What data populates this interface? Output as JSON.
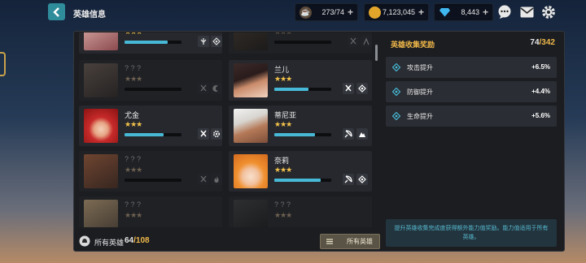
{
  "header": {
    "title": "英雄信息"
  },
  "resources": {
    "stamina": "273/74",
    "gold": "7,123,045",
    "gems": "8,443"
  },
  "heroes": [
    {
      "name": "",
      "stars": "★★★",
      "locked": false,
      "progress": 0.75
    },
    {
      "name": "",
      "stars": "★★★",
      "locked": true,
      "progress": 0.0
    },
    {
      "name": "? ? ?",
      "stars": "★★★",
      "locked": true,
      "progress": 0.0
    },
    {
      "name": "兰儿",
      "stars": "★★★",
      "locked": false,
      "progress": 0.6
    },
    {
      "name": "尤金",
      "stars": "★★★",
      "locked": false,
      "progress": 0.68
    },
    {
      "name": "蒂尼亚",
      "stars": "★★★",
      "locked": false,
      "progress": 0.72
    },
    {
      "name": "? ? ?",
      "stars": "★★★",
      "locked": true,
      "progress": 0.0
    },
    {
      "name": "奈莉",
      "stars": "★★★",
      "locked": false,
      "progress": 0.82
    },
    {
      "name": "? ? ?",
      "stars": "★★★",
      "locked": true,
      "progress": 0.0
    },
    {
      "name": "? ? ?",
      "stars": "★★★",
      "locked": true,
      "progress": 0.0
    }
  ],
  "footer": {
    "all_heroes_label": "所有英雄",
    "count": "64",
    "total": "/108",
    "filter_label": "所有英雄"
  },
  "collection": {
    "title": "英雄收集奖励",
    "count": "74",
    "total": "/342",
    "stats": [
      {
        "label": "攻击提升",
        "value": "+6.5%"
      },
      {
        "label": "防御提升",
        "value": "+4.4%"
      },
      {
        "label": "生命提升",
        "value": "+5.6%"
      }
    ],
    "note": "提升英雄收集完成度获得额外能力值奖励。能力值适用于所有英雄。"
  },
  "colors": {
    "accent": "#2f8c9b",
    "gold_text": "#f0b84a",
    "progress": "#47b9d6"
  }
}
